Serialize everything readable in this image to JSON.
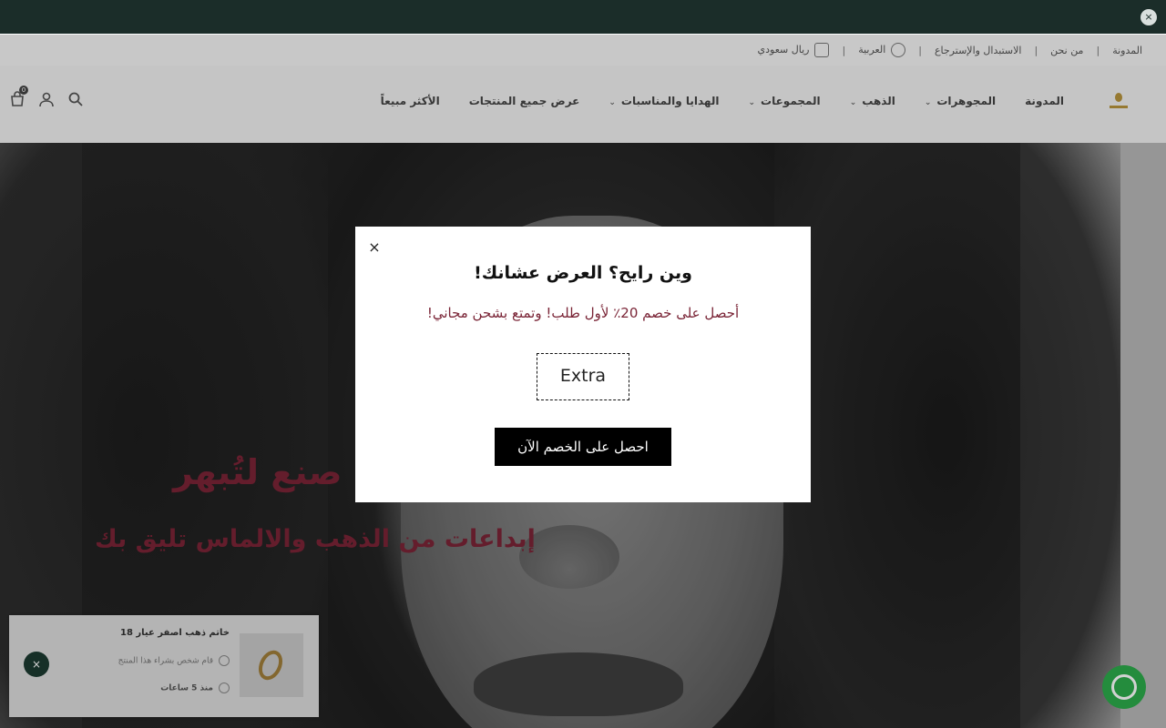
{
  "announcement": {
    "close_glyph": "×"
  },
  "top_links": {
    "items": [
      "المدونة",
      "من نحن",
      "الاستبدال والإسترجاع"
    ],
    "language": "العربية",
    "currency": "ريال سعودي"
  },
  "nav": {
    "items": [
      {
        "label": "المدونة",
        "has_dropdown": false
      },
      {
        "label": "المجوهرات",
        "has_dropdown": true
      },
      {
        "label": "الذهب",
        "has_dropdown": true
      },
      {
        "label": "المجموعات",
        "has_dropdown": true
      },
      {
        "label": "الهدايا والمناسبات",
        "has_dropdown": true
      },
      {
        "label": "عرض جميع المنتجات",
        "has_dropdown": false
      },
      {
        "label": "الأكثر مبيعاً",
        "has_dropdown": false
      }
    ],
    "cart_count": "0",
    "icons": [
      "search-icon",
      "user-icon",
      "cart-icon"
    ]
  },
  "hero": {
    "title": "صنع لتُبهر",
    "subtitle": "إبداعات من الذهب والالماس تليق بك"
  },
  "social_proof": {
    "product": "خاتم ذهب اصفر عيار 18",
    "meta": "قام شخص بشراء هذا المنتج",
    "time": "منذ 5 ساعات"
  },
  "modal": {
    "close_glyph": "×",
    "title": "وين رايح؟ العرض عشانك!",
    "subtitle": "أحصل على خصم 20٪ لأول طلب! وتمتع بشحن مجاني!",
    "coupon_code": "Extra",
    "cta_label": "احصل على الخصم الآن"
  },
  "colors": {
    "announcement_bg": "#1b2d29",
    "accent_text": "#7a2436",
    "whatsapp": "#2cab4b",
    "cta_bg": "#000000"
  }
}
